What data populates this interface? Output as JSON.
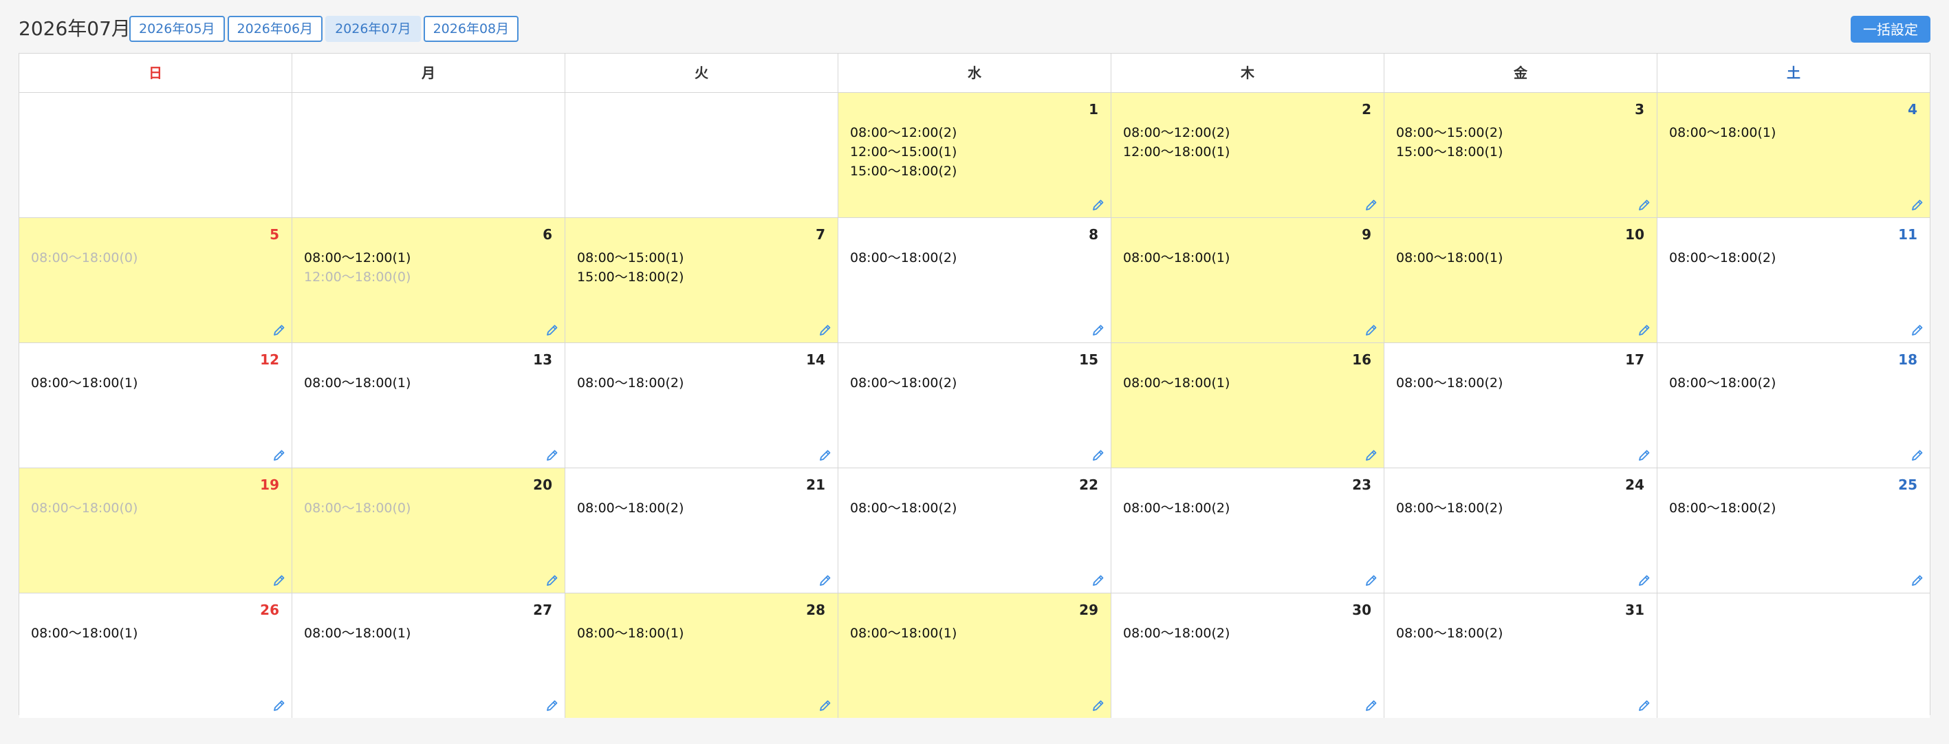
{
  "header": {
    "title": "2026年07月",
    "tabs": [
      "2026年05月",
      "2026年06月",
      "2026年07月",
      "2026年08月"
    ],
    "active_tab": 2,
    "bulk_label": "一括設定"
  },
  "calendar": {
    "weekdays": [
      "日",
      "月",
      "火",
      "水",
      "木",
      "金",
      "土"
    ],
    "weeks": [
      [
        null,
        null,
        null,
        {
          "day": "1",
          "hl": true,
          "slots": [
            {
              "t": "08:00〜12:00(2)"
            },
            {
              "t": "12:00〜15:00(1)"
            },
            {
              "t": "15:00〜18:00(2)"
            }
          ]
        },
        {
          "day": "2",
          "hl": true,
          "slots": [
            {
              "t": "08:00〜12:00(2)"
            },
            {
              "t": "12:00〜18:00(1)"
            }
          ]
        },
        {
          "day": "3",
          "hl": true,
          "slots": [
            {
              "t": "08:00〜15:00(2)"
            },
            {
              "t": "15:00〜18:00(1)"
            }
          ]
        },
        {
          "day": "4",
          "hl": true,
          "slots": [
            {
              "t": "08:00〜18:00(1)"
            }
          ]
        }
      ],
      [
        {
          "day": "5",
          "hl": true,
          "slots": [
            {
              "t": "08:00〜18:00(0)",
              "off": true
            }
          ]
        },
        {
          "day": "6",
          "hl": true,
          "slots": [
            {
              "t": "08:00〜12:00(1)"
            },
            {
              "t": "12:00〜18:00(0)",
              "off": true
            }
          ]
        },
        {
          "day": "7",
          "hl": true,
          "slots": [
            {
              "t": "08:00〜15:00(1)"
            },
            {
              "t": "15:00〜18:00(2)"
            }
          ]
        },
        {
          "day": "8",
          "hl": false,
          "slots": [
            {
              "t": "08:00〜18:00(2)"
            }
          ]
        },
        {
          "day": "9",
          "hl": true,
          "slots": [
            {
              "t": "08:00〜18:00(1)"
            }
          ]
        },
        {
          "day": "10",
          "hl": true,
          "slots": [
            {
              "t": "08:00〜18:00(1)"
            }
          ]
        },
        {
          "day": "11",
          "hl": false,
          "slots": [
            {
              "t": "08:00〜18:00(2)"
            }
          ]
        }
      ],
      [
        {
          "day": "12",
          "hl": false,
          "slots": [
            {
              "t": "08:00〜18:00(1)"
            }
          ]
        },
        {
          "day": "13",
          "hl": false,
          "slots": [
            {
              "t": "08:00〜18:00(1)"
            }
          ]
        },
        {
          "day": "14",
          "hl": false,
          "slots": [
            {
              "t": "08:00〜18:00(2)"
            }
          ]
        },
        {
          "day": "15",
          "hl": false,
          "slots": [
            {
              "t": "08:00〜18:00(2)"
            }
          ]
        },
        {
          "day": "16",
          "hl": true,
          "slots": [
            {
              "t": "08:00〜18:00(1)"
            }
          ]
        },
        {
          "day": "17",
          "hl": false,
          "slots": [
            {
              "t": "08:00〜18:00(2)"
            }
          ]
        },
        {
          "day": "18",
          "hl": false,
          "slots": [
            {
              "t": "08:00〜18:00(2)"
            }
          ]
        }
      ],
      [
        {
          "day": "19",
          "hl": true,
          "slots": [
            {
              "t": "08:00〜18:00(0)",
              "off": true
            }
          ]
        },
        {
          "day": "20",
          "hl": true,
          "slots": [
            {
              "t": "08:00〜18:00(0)",
              "off": true
            }
          ]
        },
        {
          "day": "21",
          "hl": false,
          "slots": [
            {
              "t": "08:00〜18:00(2)"
            }
          ]
        },
        {
          "day": "22",
          "hl": false,
          "slots": [
            {
              "t": "08:00〜18:00(2)"
            }
          ]
        },
        {
          "day": "23",
          "hl": false,
          "slots": [
            {
              "t": "08:00〜18:00(2)"
            }
          ]
        },
        {
          "day": "24",
          "hl": false,
          "slots": [
            {
              "t": "08:00〜18:00(2)"
            }
          ]
        },
        {
          "day": "25",
          "hl": false,
          "slots": [
            {
              "t": "08:00〜18:00(2)"
            }
          ]
        }
      ],
      [
        {
          "day": "26",
          "hl": false,
          "slots": [
            {
              "t": "08:00〜18:00(1)"
            }
          ]
        },
        {
          "day": "27",
          "hl": false,
          "slots": [
            {
              "t": "08:00〜18:00(1)"
            }
          ]
        },
        {
          "day": "28",
          "hl": true,
          "slots": [
            {
              "t": "08:00〜18:00(1)"
            }
          ]
        },
        {
          "day": "29",
          "hl": true,
          "slots": [
            {
              "t": "08:00〜18:00(1)"
            }
          ]
        },
        {
          "day": "30",
          "hl": false,
          "slots": [
            {
              "t": "08:00〜18:00(2)"
            }
          ]
        },
        {
          "day": "31",
          "hl": false,
          "slots": [
            {
              "t": "08:00〜18:00(2)"
            }
          ]
        },
        null
      ]
    ]
  },
  "colors": {
    "highlight": "#fffbaa",
    "sunday": "#e53935",
    "saturday": "#2f6fc4",
    "accent": "#3f8fe6",
    "disabled_text": "#b9b9b9"
  },
  "icons": {
    "edit": "pencil-icon"
  }
}
